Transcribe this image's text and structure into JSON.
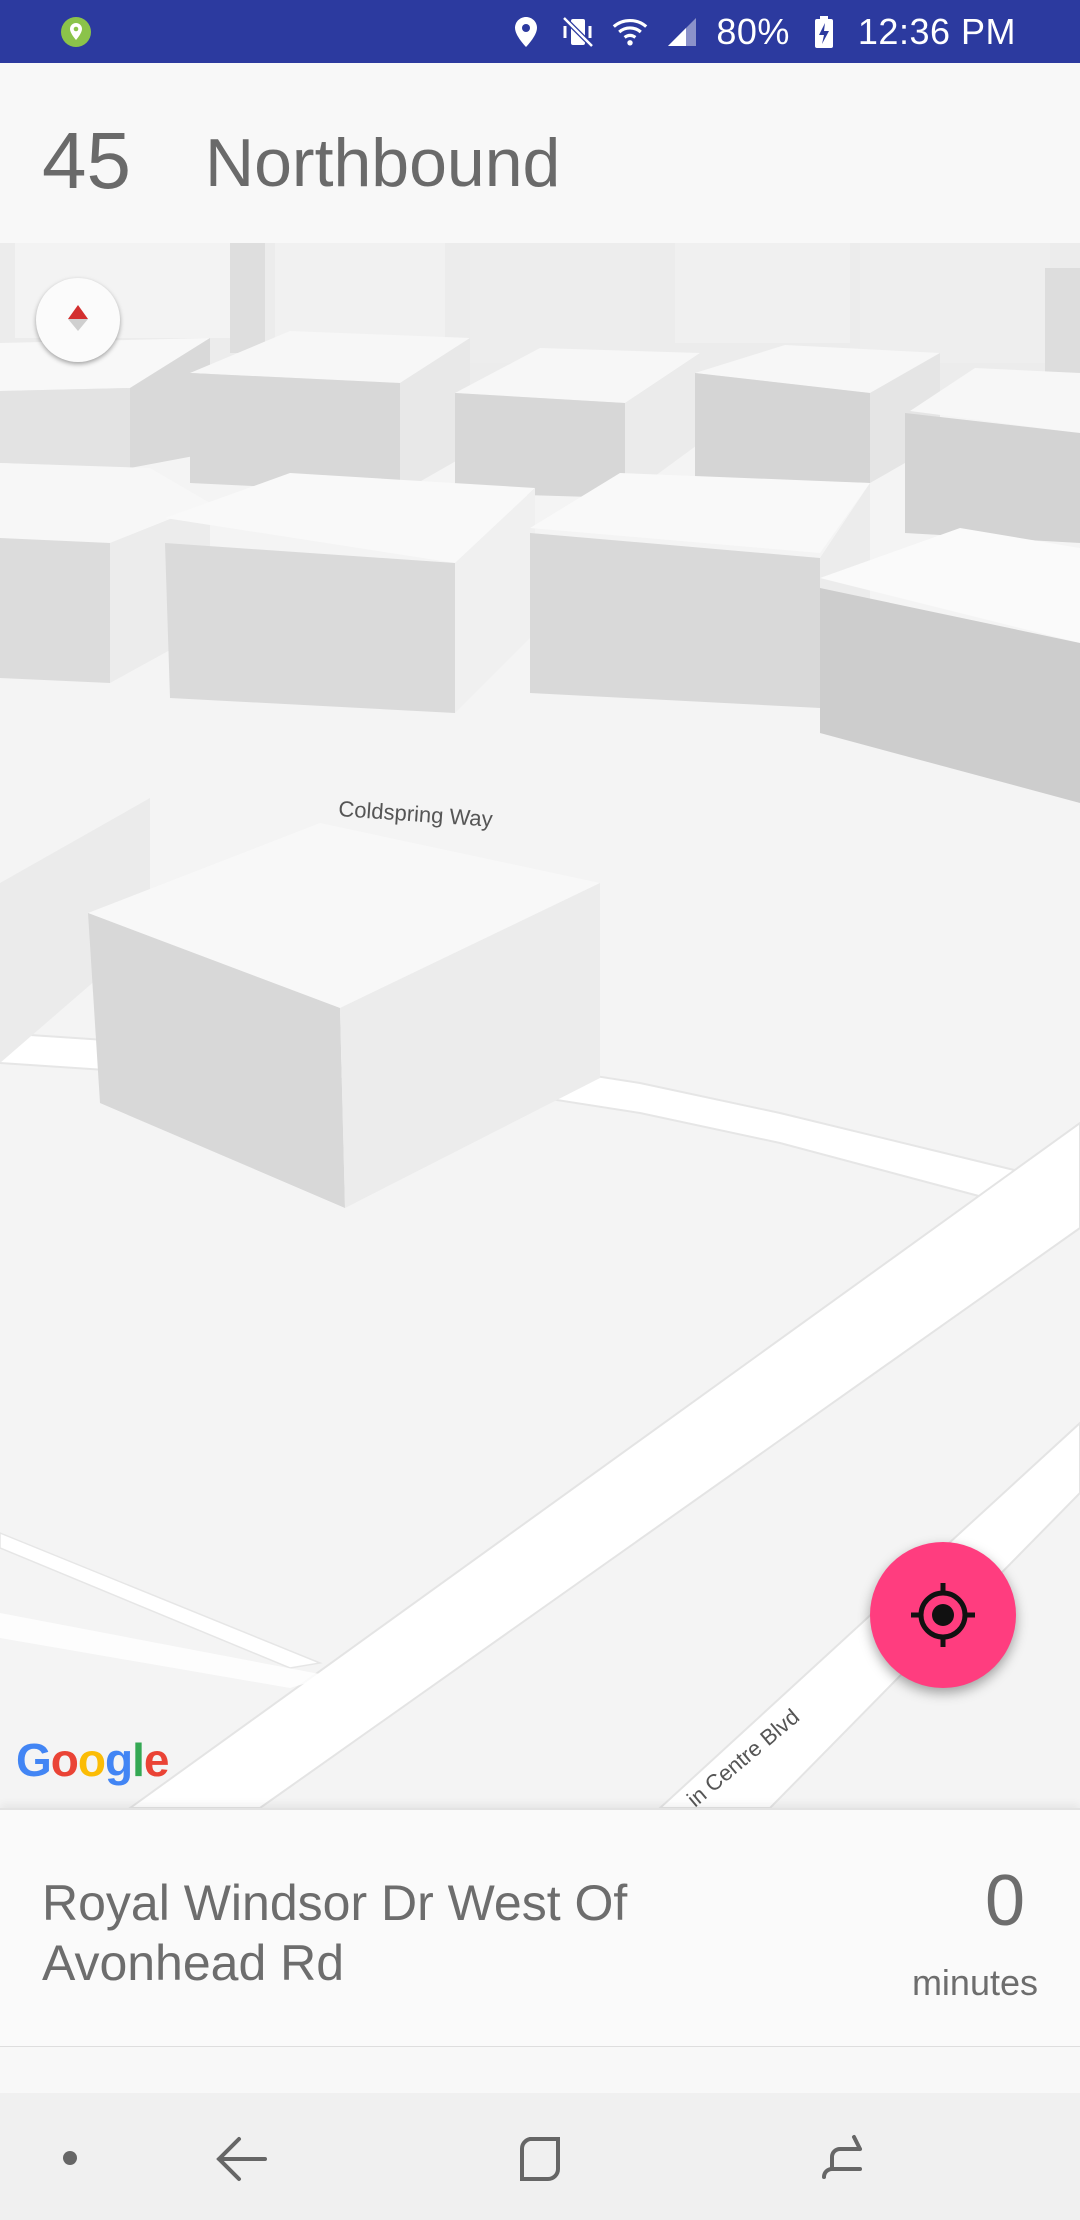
{
  "status_bar": {
    "battery": "80%",
    "time": "12:36 PM",
    "icons": [
      "location-pin-icon",
      "location-icon",
      "vibrate-mute-icon",
      "wifi-icon",
      "signal-icon",
      "battery-charging-icon"
    ]
  },
  "route": {
    "number": "45",
    "direction": "Northbound"
  },
  "map": {
    "street_labels": [
      "Coldspring Way",
      "in Centre Blvd"
    ],
    "logo_letters": [
      "G",
      "o",
      "o",
      "g",
      "l",
      "e"
    ],
    "logo_colors": [
      "#4285F4",
      "#EA4335",
      "#FBBC05",
      "#4285F4",
      "#34A853",
      "#EA4335"
    ],
    "compass_icon": "compass-icon",
    "locate_icon": "my-location-icon",
    "fab_color": "#ff3d7f"
  },
  "stop": {
    "name": "Royal Windsor Dr West Of Avonhead Rd",
    "eta_value": "0",
    "eta_unit": "minutes"
  },
  "nav_bar": {
    "icons": [
      "dot-icon",
      "back-icon",
      "home-icon",
      "recents-icon"
    ]
  }
}
